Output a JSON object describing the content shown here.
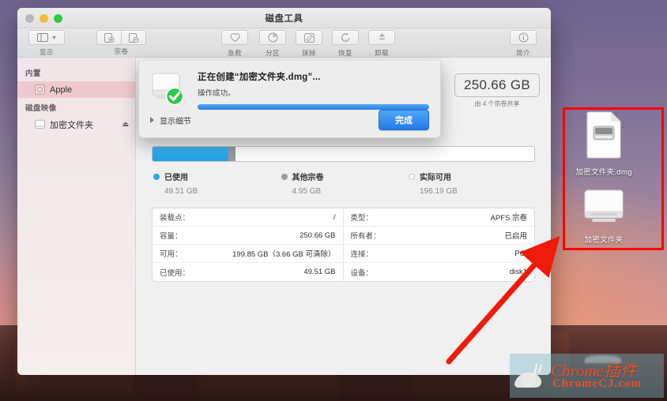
{
  "window": {
    "title": "磁盘工具",
    "traffic": {
      "close": "close-button",
      "minimize": "minimize-button",
      "maximize": "maximize-button"
    }
  },
  "toolbar": {
    "view_label": "显示",
    "volume_label": "宗卷",
    "items": [
      {
        "label": "急救",
        "icon": "first-aid-icon"
      },
      {
        "label": "分区",
        "icon": "partition-icon"
      },
      {
        "label": "抹掉",
        "icon": "erase-icon"
      },
      {
        "label": "恢复",
        "icon": "restore-icon"
      },
      {
        "label": "卸载",
        "icon": "unmount-icon"
      }
    ],
    "info_label": "简介"
  },
  "sidebar": {
    "groups": [
      {
        "header": "内置",
        "items": [
          {
            "label": "Apple",
            "selected": true,
            "eject": false
          }
        ]
      },
      {
        "header": "磁盘映像",
        "items": [
          {
            "label": "加密文件夹",
            "selected": false,
            "eject": true
          }
        ]
      }
    ]
  },
  "capacity": {
    "value": "250.66 GB",
    "note": "由 4 个宗卷共享"
  },
  "storage": {
    "legend": [
      {
        "name": "已使用",
        "value": "49.51 GB",
        "color": "#2aa8ee",
        "percent": 19.8
      },
      {
        "name": "其他宗卷",
        "value": "4.95 GB",
        "color": "#9d9d9d",
        "percent": 2.0
      },
      {
        "name": "实际可用",
        "value": "196.19 GB",
        "color": "#ffffff",
        "percent": 78.2
      }
    ]
  },
  "info_table": {
    "left": [
      {
        "key": "装载点：",
        "value": "/"
      },
      {
        "key": "容量：",
        "value": "250.66 GB"
      },
      {
        "key": "可用：",
        "value": "199.85 GB（3.66 GB 可清除）"
      },
      {
        "key": "已使用：",
        "value": "49.51 GB"
      }
    ],
    "right": [
      {
        "key": "类型：",
        "value": "APFS 宗卷"
      },
      {
        "key": "所有者：",
        "value": "已启用"
      },
      {
        "key": "连接：",
        "value": "PCI"
      },
      {
        "key": "设备：",
        "value": "disk1"
      }
    ]
  },
  "sheet": {
    "title": "正在创建“加密文件夹.dmg”...",
    "subtitle": "操作成功。",
    "progress_percent": 100,
    "disclosure_label": "显示细节",
    "done_label": "完成",
    "icon": "external-drive-icon",
    "badge": "success-check-badge"
  },
  "desktop": {
    "icons": [
      {
        "label": "加密文件夹.dmg",
        "icon": "disk-image-file-icon"
      },
      {
        "label": "加密文件夹",
        "icon": "mounted-volume-icon"
      }
    ]
  },
  "annotations": {
    "highlight_color": "#ff0000",
    "arrow_color": "#f01a0a"
  },
  "watermark": {
    "line1": "Chrome插件",
    "line2": "ChromeCJ.com",
    "accent": "#e8502a"
  }
}
